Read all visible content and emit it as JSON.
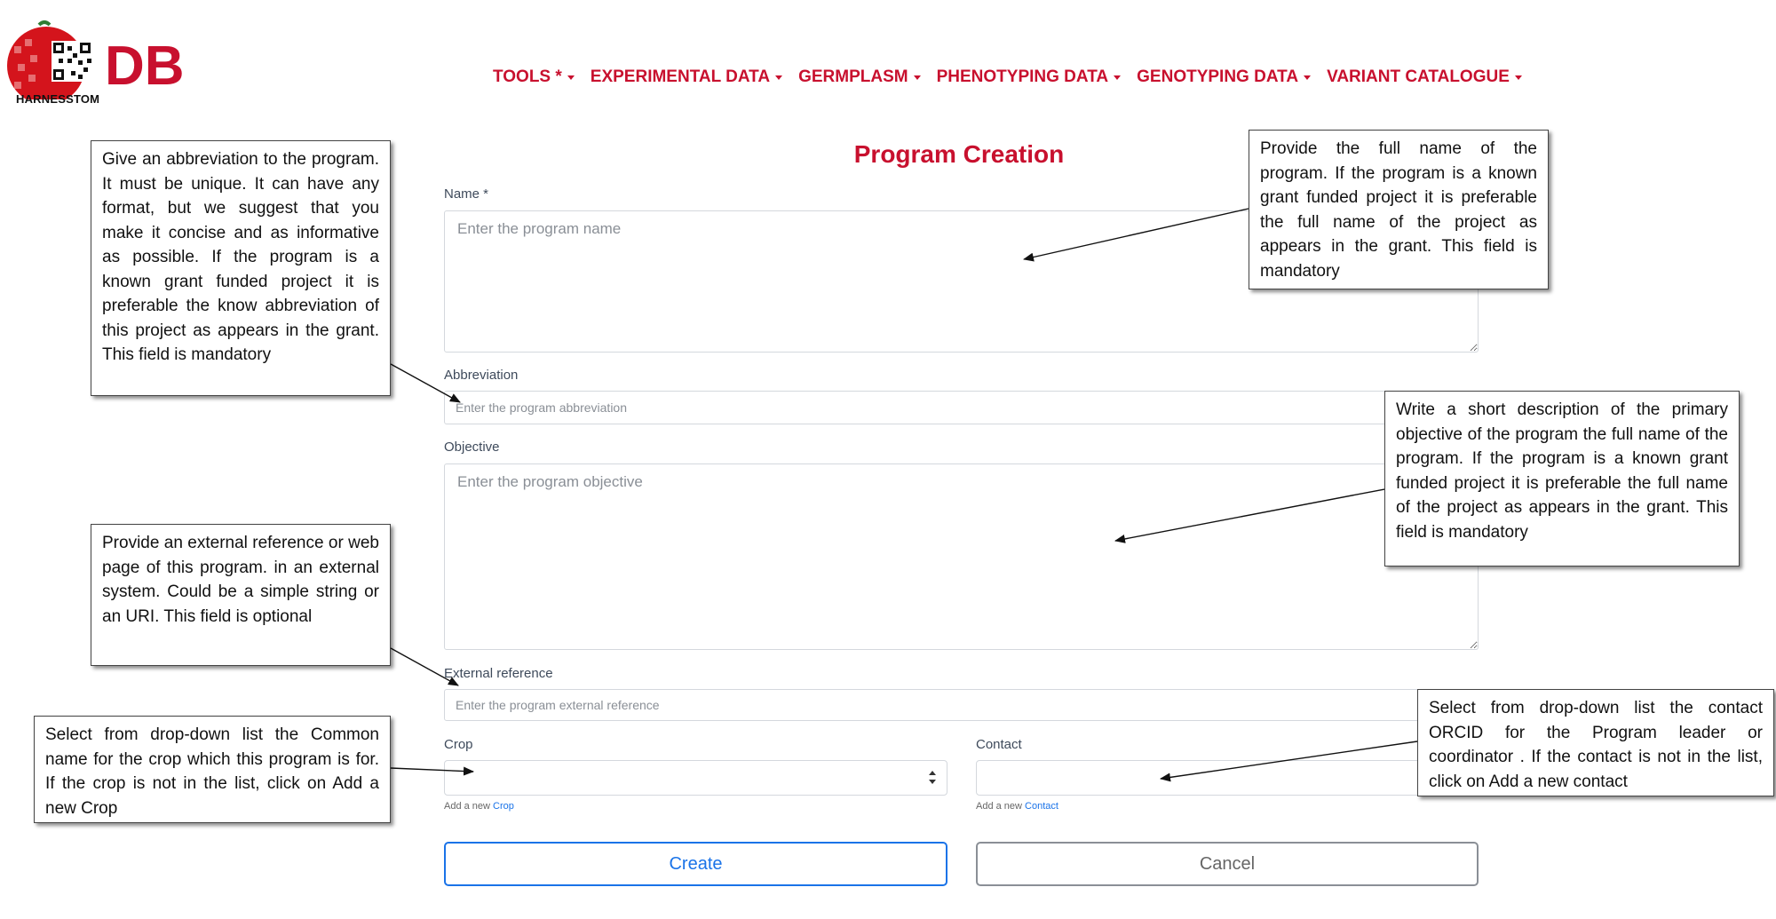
{
  "brand": {
    "logo_caption": "HARNESSTOM",
    "logo_suffix": "DB"
  },
  "nav": [
    {
      "label": "TOOLS *"
    },
    {
      "label": "EXPERIMENTAL DATA"
    },
    {
      "label": "GERMPLASM"
    },
    {
      "label": "PHENOTYPING DATA"
    },
    {
      "label": "GENOTYPING DATA"
    },
    {
      "label": "VARIANT CATALOGUE"
    }
  ],
  "form": {
    "title": "Program Creation",
    "name": {
      "label": "Name *",
      "placeholder": "Enter the program name"
    },
    "abbreviation": {
      "label": "Abbreviation",
      "placeholder": "Enter the program abbreviation"
    },
    "objective": {
      "label": "Objective",
      "placeholder": "Enter the program objective"
    },
    "external_reference": {
      "label": "External reference",
      "placeholder": "Enter the program external reference"
    },
    "crop": {
      "label": "Crop",
      "help_prefix": "Add a new",
      "help_link": "Crop"
    },
    "contact": {
      "label": "Contact",
      "help_prefix": "Add a new",
      "help_link": "Contact"
    },
    "create_label": "Create",
    "cancel_label": "Cancel"
  },
  "callouts": {
    "abbreviation": "Give an abbreviation to the program.  It must be unique. It can have any format, but we suggest that you make it concise and as informative as possible. If the program is a known grant funded project it is preferable the know abbreviation of this project as appears in the grant. This field is mandatory",
    "name": "Provide the full name of the program. If the program is a known grant funded project it is preferable the full name of the project as appears in the grant. This field is mandatory",
    "objective": "Write a short description of the primary objective of the program the full name of the program. If the program is a known grant funded project it is preferable the full name of the project as appears in the grant. This field is mandatory",
    "external_reference": "Provide an external reference or web page of this program. in an external system. Could be a simple string or an URI. This field is optional",
    "crop": "Select from drop-down list the Common name for the crop which this program is for. If the crop is not in the list, click on Add a new Crop",
    "contact": "Select from drop-down list the contact ORCID for the Program leader or coordinator . If the contact is not in the list, click on Add a new contact"
  },
  "colors": {
    "brand_red": "#c8102e",
    "link_blue": "#1a73e8",
    "border_grey": "#d4d8dd"
  }
}
